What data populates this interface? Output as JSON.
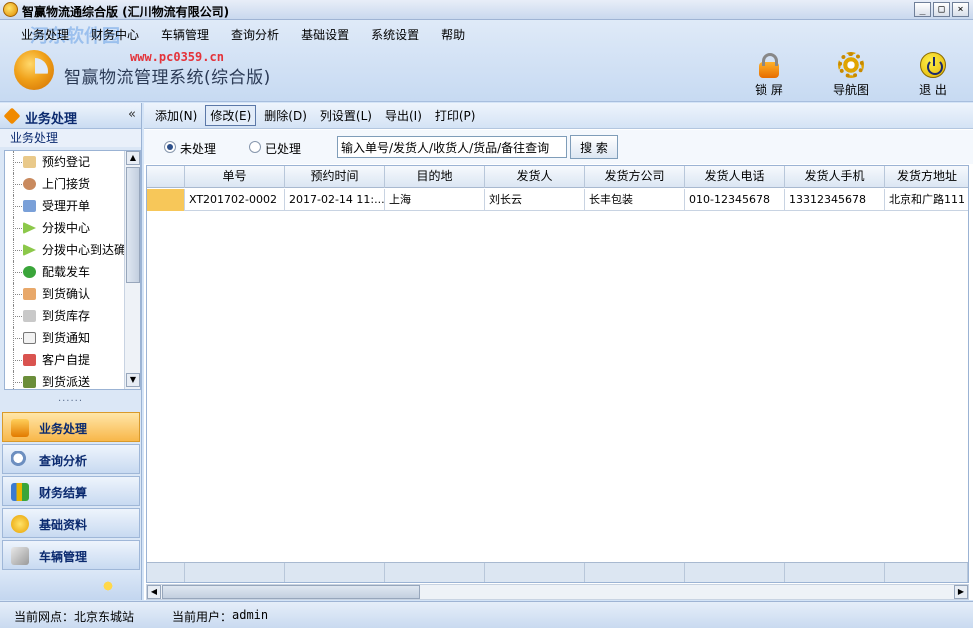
{
  "window": {
    "title": "智赢物流通综合版 (汇川物流有限公司)",
    "controls": {
      "minimize": "_",
      "maximize": "□",
      "close": "×"
    }
  },
  "watermark": {
    "brand": "河东软件园",
    "url": "www.pc0359.cn"
  },
  "menu": [
    "业务处理",
    "财务中心",
    "车辆管理",
    "查询分析",
    "基础设置",
    "系统设置",
    "帮助"
  ],
  "app": {
    "name": "智赢物流管理系统(综合版)"
  },
  "toolbar_right": {
    "lock": "锁 屏",
    "nav": "导航图",
    "exit": "退 出"
  },
  "left_panel": {
    "title": "业务处理",
    "collapse": "«",
    "subtitle": "业务处理",
    "items": [
      "预约登记",
      "上门接货",
      "受理开单",
      "分拨中心",
      "分拨中心到达确",
      "配载发车",
      "到货确认",
      "到货库存",
      "到货通知",
      "客户自提",
      "到货派送"
    ],
    "splitter": "......",
    "nav": [
      "业务处理",
      "查询分析",
      "财务结算",
      "基础资料",
      "车辆管理"
    ]
  },
  "actions": [
    "添加(N)",
    "修改(E)",
    "删除(D)",
    "列设置(L)",
    "导出(I)",
    "打印(P)"
  ],
  "filter": {
    "option_pending": "未处理",
    "option_done": "已处理",
    "search_value": "输入单号/发货人/收货人/货品/备往查询",
    "search_button": "搜 索"
  },
  "table": {
    "columns": [
      "单号",
      "预约时间",
      "目的地",
      "发货人",
      "发货方公司",
      "发货人电话",
      "发货人手机",
      "发货方地址"
    ],
    "rows": [
      [
        "XT201702-0002",
        "2017-02-14 11:...",
        "上海",
        "刘长云",
        "长丰包装",
        "010-12345678",
        "13312345678",
        "北京和广路111"
      ]
    ]
  },
  "status": {
    "site_label": "当前网点：",
    "site_value": "北京东城站",
    "user_label": "当前用户：",
    "user_value": "admin"
  },
  "colors": {
    "accent": "#f8b74a",
    "header": "#c7daf2",
    "row_indicator": "#f7c759"
  }
}
